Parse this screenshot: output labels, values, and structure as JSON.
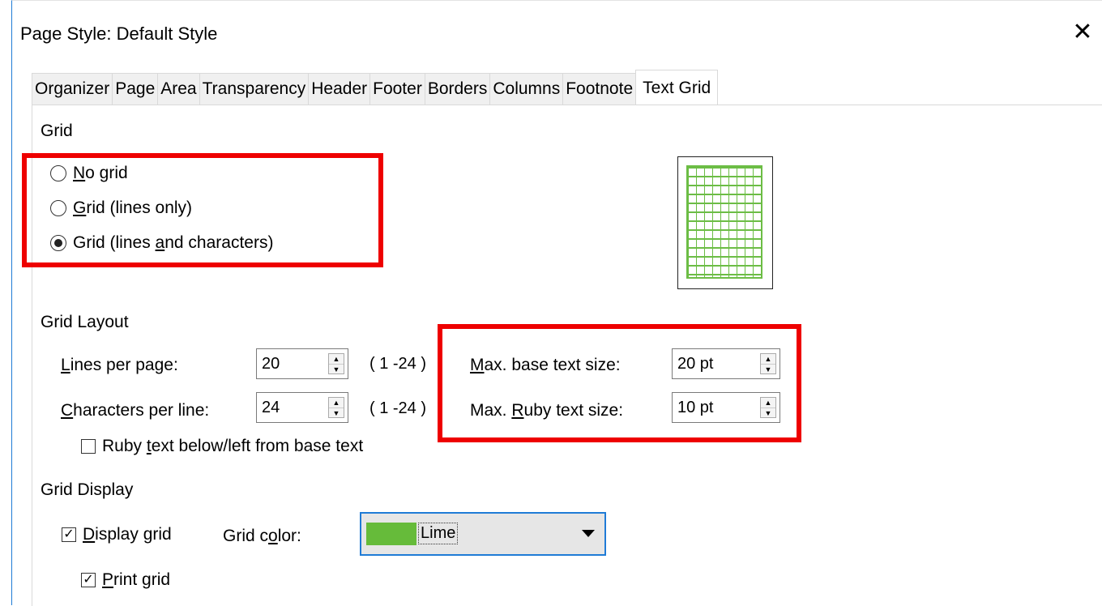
{
  "window": {
    "title": "Page Style: Default Style",
    "close_glyph": "✕"
  },
  "tabs": [
    {
      "label": "Organizer"
    },
    {
      "label": "Page"
    },
    {
      "label": "Area"
    },
    {
      "label": "Transparency"
    },
    {
      "label": "Header"
    },
    {
      "label": "Footer"
    },
    {
      "label": "Borders"
    },
    {
      "label": "Columns"
    },
    {
      "label": "Footnote"
    },
    {
      "label": "Text Grid",
      "active": true
    }
  ],
  "grid": {
    "heading": "Grid",
    "options": [
      {
        "pre": "",
        "key": "N",
        "post": "o grid",
        "selected": false
      },
      {
        "pre": "",
        "key": "G",
        "post": "rid (lines only)",
        "selected": false
      },
      {
        "pre": "Grid (lines ",
        "key": "a",
        "post": "nd characters)",
        "selected": true
      }
    ]
  },
  "layout": {
    "heading": "Grid Layout",
    "lines_label_key": "L",
    "lines_label_rest": "ines per page:",
    "lines_value": "20",
    "lines_range": "( 1 -24 )",
    "chars_label_key": "C",
    "chars_label_rest": "haracters per line:",
    "chars_value": "24",
    "chars_range": "( 1 -24 )",
    "max_base_key": "M",
    "max_base_rest": "ax. base text size:",
    "max_base_value": "20 pt",
    "max_ruby_pre": "Max. ",
    "max_ruby_key": "R",
    "max_ruby_rest": "uby text size:",
    "max_ruby_value": "10 pt",
    "ruby_below_pre": "Ruby ",
    "ruby_below_key": "t",
    "ruby_below_rest": "ext below/left from base text",
    "ruby_below_checked": false
  },
  "display": {
    "heading": "Grid Display",
    "display_grid_key": "D",
    "display_grid_rest": "isplay grid",
    "display_grid_checked": true,
    "color_label_pre": "Grid c",
    "color_label_key": "o",
    "color_label_rest": "lor:",
    "color_value": "Lime",
    "color_hex": "#66bb3a",
    "print_grid_key": "P",
    "print_grid_rest": "rint grid",
    "print_grid_checked": true
  },
  "colors": {
    "highlight": "#ee0000",
    "accent": "#1f7bd6",
    "grid_lime": "#6cbd45"
  }
}
